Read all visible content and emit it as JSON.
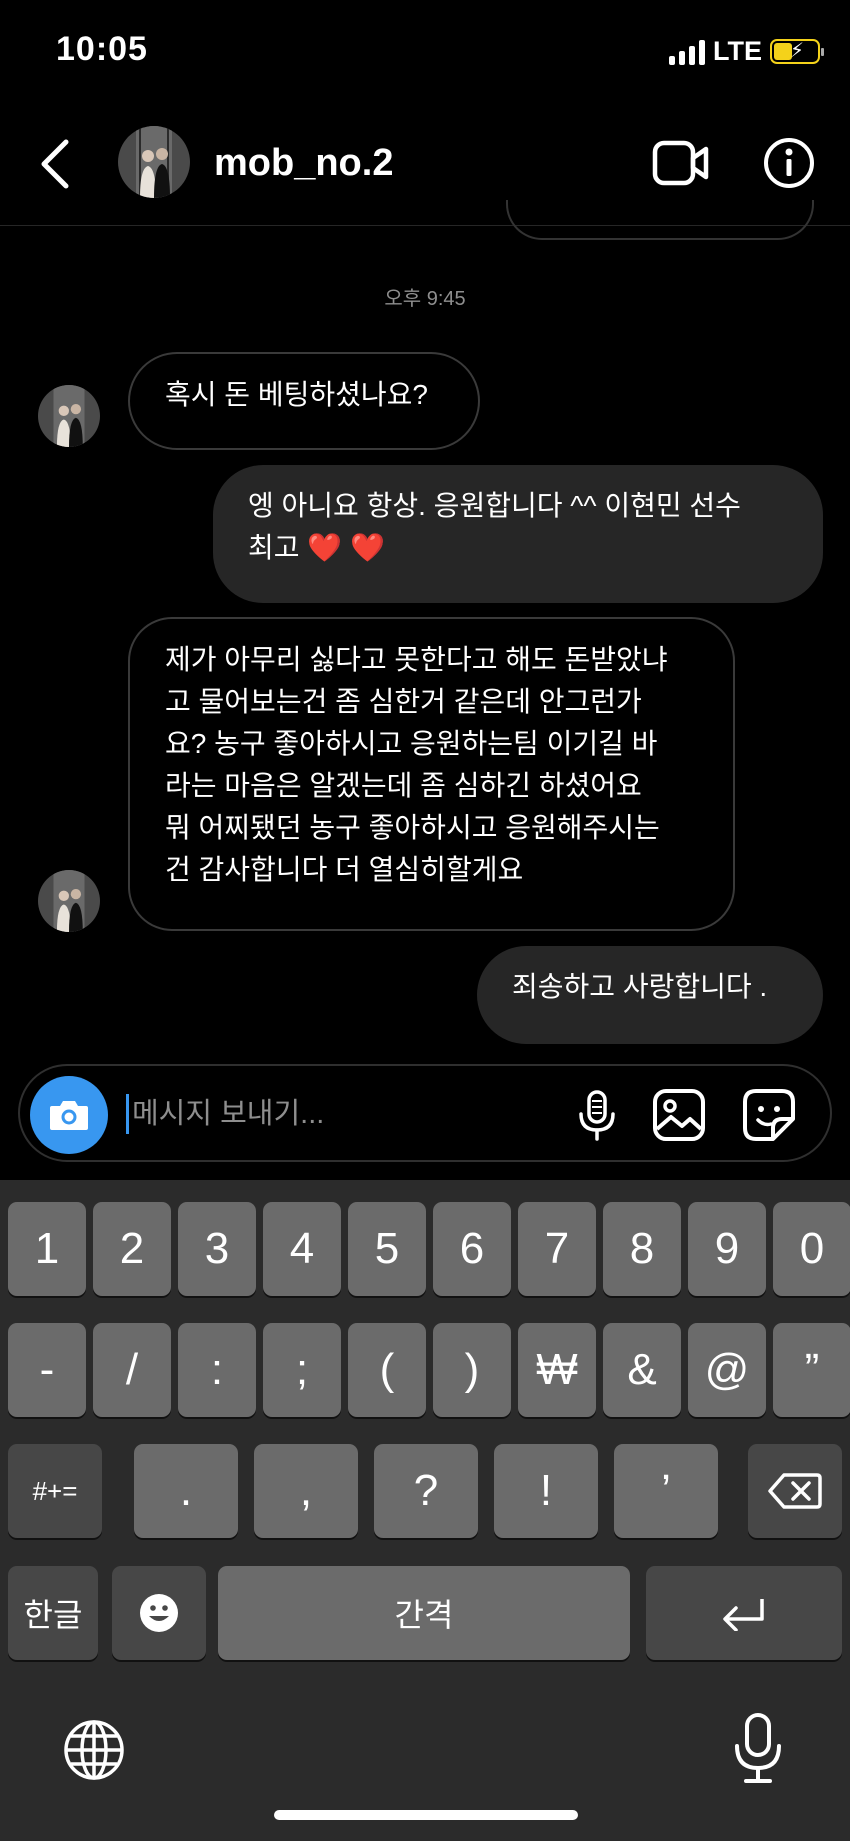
{
  "status_bar": {
    "time": "10:05",
    "network": "LTE"
  },
  "header": {
    "username": "mob_no.2"
  },
  "thread": {
    "timestamp": "오후 9:45",
    "messages": [
      {
        "direction": "received",
        "text": "혹시 돈 베팅하셨나요?"
      },
      {
        "direction": "sent",
        "text": "엥 아니요 항상. 응원합니다 ^^ 이현민 선수\n최고 ❤️ ❤️"
      },
      {
        "direction": "received",
        "text": "제가 아무리 싫다고 못한다고 해도 돈받았냐\n고 물어보는건 좀 심한거 같은데 안그런가\n요? 농구 좋아하시고 응원하는팀 이기길 바\n라는 마음은 알겠는데 좀 심하긴 하셨어요\n뭐 어찌됐던 농구 좋아하시고 응원해주시는\n건 감사합니다 더 열심히할게요"
      },
      {
        "direction": "sent",
        "text": "죄송하고 사랑합니다 ."
      }
    ]
  },
  "composer": {
    "placeholder": "메시지 보내기..."
  },
  "keyboard": {
    "row1": [
      "1",
      "2",
      "3",
      "4",
      "5",
      "6",
      "7",
      "8",
      "9",
      "0"
    ],
    "row2": [
      "-",
      "/",
      ":",
      ";",
      "(",
      ")",
      "₩",
      "&",
      "@",
      "”"
    ],
    "row3": [
      ".",
      ",",
      "?",
      "!",
      "’"
    ],
    "symbols_key": "#+=",
    "lang_key": "한글",
    "space_key": "간격"
  },
  "colors": {
    "accent": "#3897f0",
    "battery": "#f4d21a",
    "sent_bubble": "#262626",
    "heart": "#e0245e"
  },
  "icons": [
    "back-icon",
    "video-call-icon",
    "info-icon",
    "camera-icon",
    "microphone-icon",
    "gallery-icon",
    "sticker-icon",
    "backspace-icon",
    "emoji-icon",
    "return-icon",
    "globe-icon",
    "dictation-icon"
  ]
}
